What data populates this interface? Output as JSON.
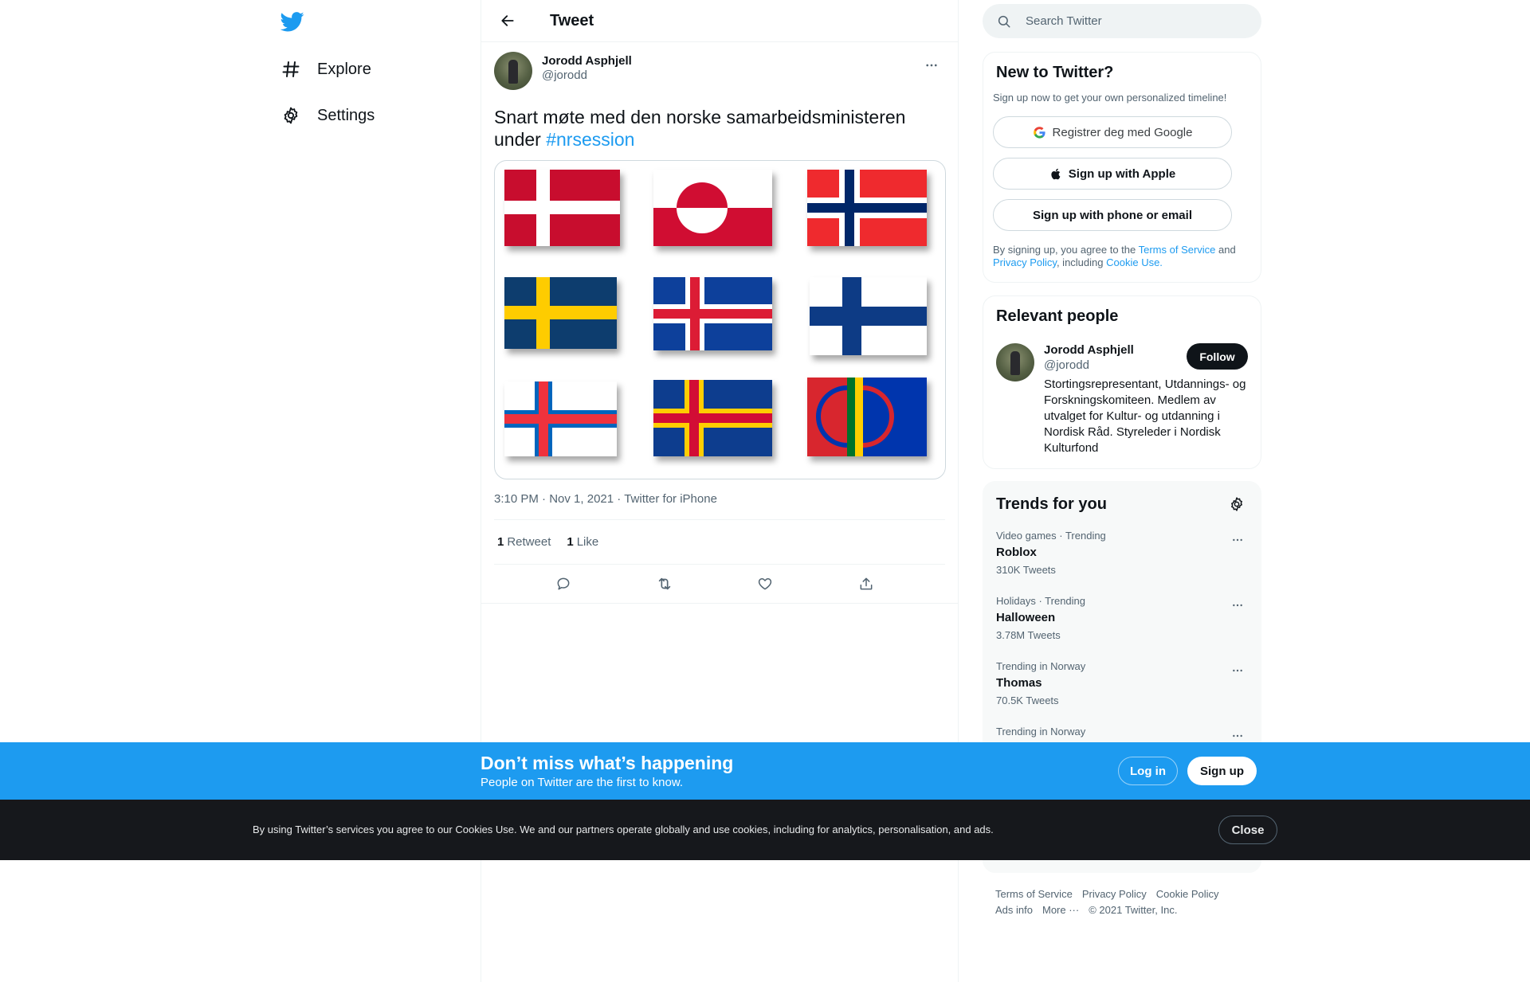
{
  "nav": {
    "logo_icon": "twitter-bird-icon",
    "items": [
      {
        "label": "Explore",
        "icon": "hashtag-icon"
      },
      {
        "label": "Settings",
        "icon": "gear-icon"
      }
    ]
  },
  "header": {
    "title": "Tweet",
    "back_icon": "arrow-left-icon"
  },
  "tweet": {
    "author_name": "Jorodd Asphjell",
    "author_handle": "@jorodd",
    "text": "Snart møte med den norske samarbeidsministeren under ",
    "hashtag": "#nrsession",
    "media_description_icon": "nordic-flags-image",
    "time": "3:10 PM",
    "date": "Nov 1, 2021",
    "separator": "·",
    "source": "Twitter for iPhone",
    "retweet_count": "1",
    "retweet_label": "Retweet",
    "like_count": "1",
    "like_label": "Like",
    "actions": [
      "reply-icon",
      "retweet-icon",
      "like-icon",
      "share-icon"
    ]
  },
  "search": {
    "placeholder": "Search Twitter"
  },
  "signup_card": {
    "title": "New to Twitter?",
    "subtitle": "Sign up now to get your own personalized timeline!",
    "google_button": "Registrer deg med Google",
    "apple_button": "Sign up with Apple",
    "phone_button": "Sign up with phone or email",
    "terms_prefix": "By signing up, you agree to the ",
    "terms_link": "Terms of Service",
    "terms_and": " and ",
    "privacy_link": "Privacy Policy",
    "terms_including": ", including ",
    "cookie_link": "Cookie Use."
  },
  "people_card": {
    "title": "Relevant people",
    "name": "Jorodd Asphjell",
    "handle": "@jorodd",
    "bio": "Stortingsrepresentant, Utdannings- og Forskningskomiteen. Medlem av utvalget for Kultur- og utdanning i Nordisk Råd. Styreleder i Nordisk Kulturfond",
    "follow_label": "Follow"
  },
  "trends_card": {
    "title": "Trends for you",
    "items": [
      {
        "category": "Video games · Trending",
        "name": "Roblox",
        "count": "310K Tweets"
      },
      {
        "category": "Holidays · Trending",
        "name": "Halloween",
        "count": "3.78M Tweets"
      },
      {
        "category": "Trending in Norway",
        "name": "Thomas",
        "count": "70.5K Tweets"
      },
      {
        "category": "Trending in Norway",
        "name": "",
        "count": ""
      }
    ]
  },
  "footer": {
    "links": [
      "Terms of Service",
      "Privacy Policy",
      "Cookie Policy",
      "Ads info",
      "More ···"
    ],
    "copyright": "© 2021 Twitter, Inc."
  },
  "signup_bar": {
    "title": "Don’t miss what’s happening",
    "subtitle": "People on Twitter are the first to know.",
    "login_label": "Log in",
    "signup_label": "Sign up"
  },
  "cookie_bar": {
    "text": "By using Twitter’s services you agree to our Cookies Use. We and our partners operate globally and use cookies, including for analytics, personalisation, and ads.",
    "close_label": "Close"
  },
  "colors": {
    "accent": "#1d9bf0",
    "text": "#0f1419",
    "muted": "#536471",
    "dark_bar": "#16181c"
  }
}
